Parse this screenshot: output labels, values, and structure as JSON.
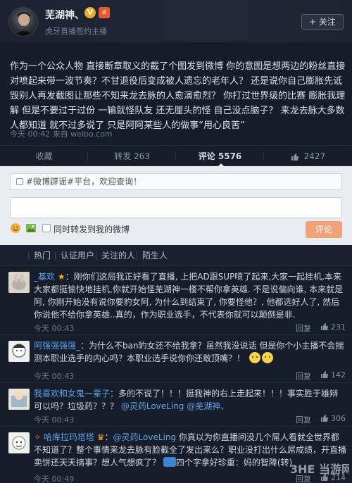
{
  "header": {
    "username": "芜湖神、",
    "verified_badge": "V",
    "level_badge": "ఠ",
    "subtitle": "虎牙直播签约主播",
    "follow_label": "+ 关注"
  },
  "post": {
    "text": "作为一个公众人物 直接断章取义的截了个图发到微博 你的意图是想两边的粉丝直接对喷起来带一波节奏？不甘退役后变成被人遗忘的老年人？ 还是说你自己膨胀先诋毁别人再发截图让那些不知来龙去脉的人愈演愈烈？ 你打过世界级的比赛 膨胀我理解 但是不要过于过份 一输就怪队友 还无厘头的怪 自己没点脑子？ 来龙去脉大多数人都知道 就不过多说了 只是阿阿某些人的做事“用心良苦”",
    "meta": "今天 00:42 来自 weibo.com"
  },
  "actions": {
    "favorite": "收藏",
    "repost": "转发 263",
    "comment": "评论 5576",
    "like": "2427"
  },
  "composer": {
    "tip": "#微博辟谣#平台，欢迎查询！",
    "repost_label": "同时转发到我的微博",
    "submit_label": "评论"
  },
  "filters": [
    "热门",
    "认证用户",
    "关注的人",
    "陌生人"
  ],
  "comments": [
    {
      "name": "_基欢",
      "badge": "★",
      "text": "：刚你们这局我正好看了直播, 上把AD跟SUP喷了起来,大家一起挂机,本来大家都挺愉快地挂机,你就开始怪芜湖神一楼不帮你拿英雄. 不是说偏向谁, 本来就是阿, 你刚开始没有说你要豹女阿, 为什么到结束了, 你要怪他？, 他都选好人了, 然后你说他不给你拿英雄..真的，作为职业选手，不代表你就可以颠倒是非.",
      "time": "今天 00:43",
      "reply": "回复",
      "likes": "231"
    },
    {
      "name": "阿强强强强_",
      "text": "：为什么不ban豹女还不给我拿？虽然我没说话 但是你个小主播不会揣测本职业选手的内心吗？本职业选手说你你还敢顶嘴？！",
      "time": "今天 00:43",
      "reply": "回复",
      "likes": "142"
    },
    {
      "name": "我喜欢和女鬼一辈子",
      "text": "：多的不说了！！！挺我神的右上走起来！！！事实胜于雄辩可以吗？垃圾药？？？",
      "mention1": "@灵药LoveLing",
      "mention2": "@芜湖神、",
      "time": "今天 00:43",
      "reply": "回复",
      "likes": "306"
    },
    {
      "name": "哈库拉玛塔塔",
      "mention": "@灵药LoveLing",
      "text": "你真以为你直播间没几个屌人看就全世界都不知道了？整个事情来龙去脉有脸截全了发出来么？职业没打出什么屌成绩，开直播卖饼还天天搞事？想人气想疯了？",
      "quote": "四个字拿好珍重：妈的智障(转)",
      "time": "今天 00:49",
      "reply": "回复",
      "likes": "214"
    }
  ],
  "watermark": "3HE 当游网"
}
